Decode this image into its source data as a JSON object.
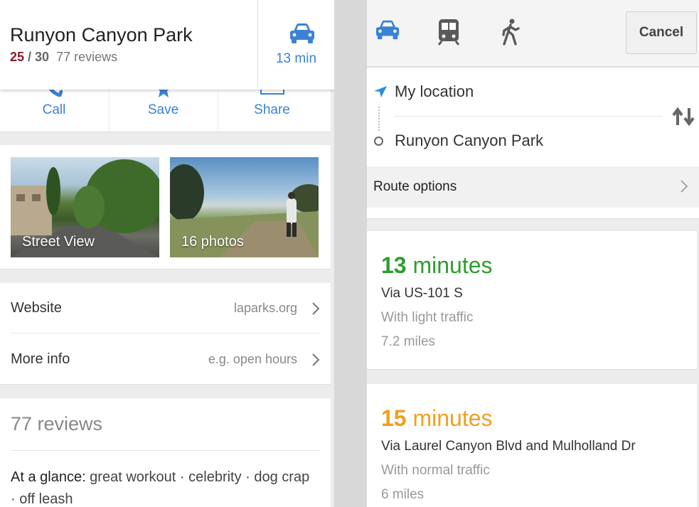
{
  "place": {
    "title": "Runyon Canyon Park",
    "score": "25",
    "score_out_of": "/ 30",
    "review_count_text": "77 reviews",
    "drive_time": "13 min"
  },
  "actions": [
    {
      "label": "Call",
      "icon": "phone-icon"
    },
    {
      "label": "Save",
      "icon": "star-icon"
    },
    {
      "label": "Share",
      "icon": "share-icon"
    }
  ],
  "photos": {
    "street_view": "Street View",
    "photos_count": "16 photos"
  },
  "links": {
    "website_label": "Website",
    "website_value": "laparks.org",
    "more_info_label": "More info",
    "more_info_value": "e.g. open hours"
  },
  "reviews": {
    "title": "77 reviews",
    "glance_label": "At a glance:",
    "glance_text": " great workout · celebrity · dog crap · off leash"
  },
  "directions": {
    "cancel_label": "Cancel",
    "modes": [
      "car-icon",
      "transit-icon",
      "walk-icon"
    ],
    "origin": "My location",
    "destination": "Runyon Canyon Park",
    "route_options_label": "Route options",
    "routes": [
      {
        "time_num": "13",
        "time_unit": " minutes",
        "via": "Via US-101 S",
        "traffic": "With light traffic",
        "distance": "7.2 miles",
        "color": "#2e9e2e"
      },
      {
        "time_num": "15",
        "time_unit": " minutes",
        "via": "Via Laurel Canyon Blvd and Mulholland Dr",
        "traffic": "With normal traffic",
        "distance": "6 miles",
        "color": "#f0a020"
      }
    ]
  },
  "colors": {
    "accent_blue": "#3a82d6",
    "rating_red": "#8b1b2b",
    "fast_green": "#2e9e2e",
    "slow_orange": "#f0a020"
  }
}
